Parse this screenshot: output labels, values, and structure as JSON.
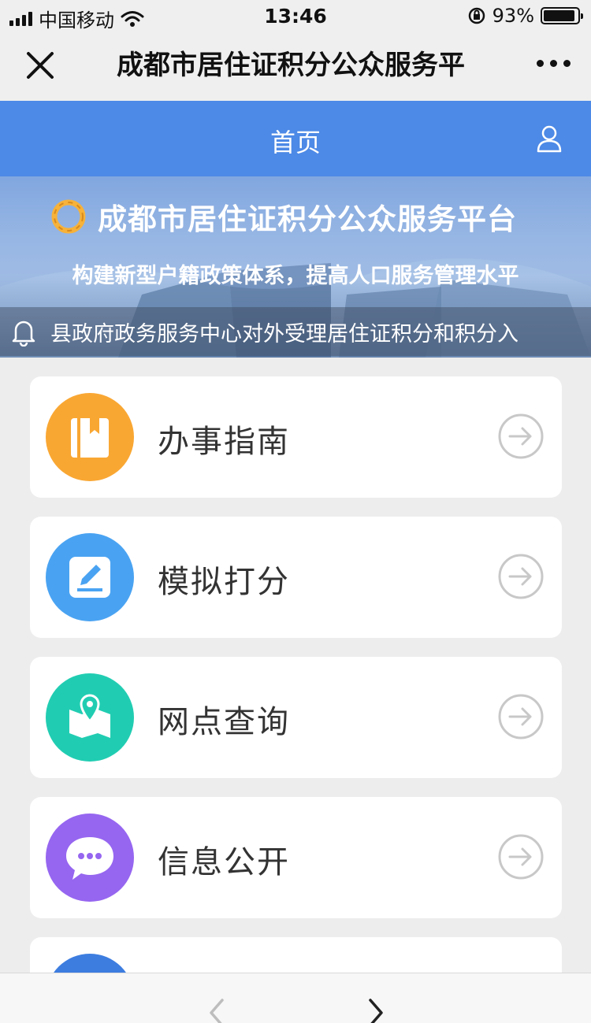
{
  "status_bar": {
    "carrier": "中国移动",
    "time": "13:46",
    "battery_percent": "93%",
    "battery_level": 0.93
  },
  "title_bar": {
    "title": "成都市居住证积分公众服务平"
  },
  "nav": {
    "title": "首页"
  },
  "banner": {
    "title": "成都市居住证积分公众服务平台",
    "slogan": "构建新型户籍政策体系，提高人口服务管理水平",
    "notice": "县政府政务服务中心对外受理居住证积分和积分入"
  },
  "menu": [
    {
      "label": "办事指南",
      "icon": "book-icon",
      "color": "#f9a733"
    },
    {
      "label": "模拟打分",
      "icon": "edit-icon",
      "color": "#4aa3f2"
    },
    {
      "label": "网点查询",
      "icon": "map-pin-icon",
      "color": "#21cdb2"
    },
    {
      "label": "信息公开",
      "icon": "chat-bubble-icon",
      "color": "#9666f0"
    }
  ],
  "colors": {
    "nav_blue": "#4d89e6",
    "partial_card_icon": "#3d7de0"
  }
}
